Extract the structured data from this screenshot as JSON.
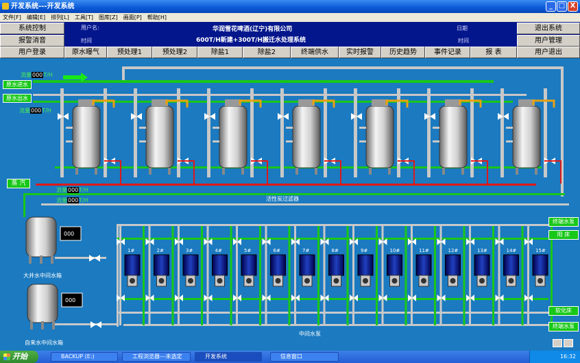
{
  "window": {
    "title": "开发系统---开发系统",
    "buttons": [
      "_",
      "□",
      "X"
    ]
  },
  "menu": [
    "文件[F]",
    "编辑[E]",
    "排列[L]",
    "工具[T]",
    "图库[Z]",
    "画面[P]",
    "帮助[H]"
  ],
  "header": {
    "system_control": "系统控制",
    "alarm_silence": "报警消音",
    "user_name_label": "用户名:",
    "time_label": "时间",
    "company": "华润雪花啤酒(辽宁)有限公司",
    "system_title": "600T/H新建+300T/H搬迁水处理系统",
    "date_label": "日期",
    "time_label_right": "时间",
    "exit_system": "退出系统",
    "user_management": "用户管理"
  },
  "nav": [
    "用户登录",
    "原水曝气",
    "预处理1",
    "预处理2",
    "除盐1",
    "除盐2",
    "终端供水",
    "实时报警",
    "历史趋势",
    "事件记录",
    "报  表",
    "用户退出"
  ],
  "process": {
    "flow_label": "流量",
    "flow_unit": "T/H",
    "flow_value": "000",
    "raw_water_in": "原水进水",
    "raw_water_out": "原水出水",
    "steam": "蒸 汽",
    "carbon_filter": "活性炭过滤器",
    "tank1_value": "000",
    "tank1_label": "大井水中间水箱",
    "tank2_value": "000",
    "tank2_label": "自来水中间水箱",
    "terminal_pump": "终端水泵",
    "cation_bed": "阳 床",
    "softener": "软化床",
    "terminal_pump2": "终端水泵",
    "mid_pump_label": "中间水泵",
    "pumps": [
      "1#",
      "2#",
      "3#",
      "4#",
      "5#",
      "6#",
      "7#",
      "8#",
      "9#",
      "10#",
      "11#",
      "12#",
      "13#",
      "14#",
      "15#"
    ]
  },
  "taskbar": {
    "start": "开始",
    "tasks": [
      "BACKUP (E:)",
      "工程浏览器---未选定",
      "开发系统",
      "信息窗口"
    ],
    "clock": "16:32"
  },
  "colors": {
    "background": "#1b7ac0",
    "pipe_green": "#18c818",
    "pipe_red": "#e01818",
    "pipe_grey": "#c8c8c8",
    "header_bg": "#04168c"
  }
}
